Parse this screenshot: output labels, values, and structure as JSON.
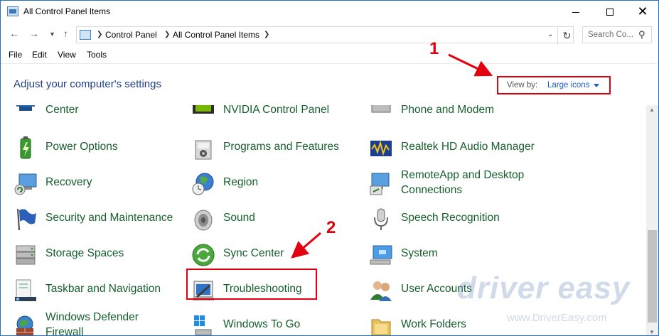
{
  "window": {
    "title": "All Control Panel Items",
    "close_glyph": "✕"
  },
  "address": {
    "crumbs": [
      "Control Panel",
      "All Control Panel Items"
    ],
    "search_placeholder": "Search Co..."
  },
  "menu": [
    "File",
    "Edit",
    "View",
    "Tools"
  ],
  "header": {
    "title": "Adjust your computer's settings",
    "view_by_label": "View by:",
    "view_by_value": "Large icons"
  },
  "items": {
    "col1": [
      "Center",
      "Power Options",
      "Recovery",
      "Security and Maintenance",
      "Storage Spaces",
      "Taskbar and Navigation",
      "Windows Defender Firewall"
    ],
    "col2": [
      "NVIDIA Control Panel",
      "Programs and Features",
      "Region",
      "Sound",
      "Sync Center",
      "Troubleshooting",
      "Windows To Go"
    ],
    "col3": [
      "Phone and Modem",
      "Realtek HD Audio Manager",
      "RemoteApp and Desktop Connections",
      "Speech Recognition",
      "System",
      "User Accounts",
      "Work Folders"
    ]
  },
  "annotations": {
    "marker_1": "1",
    "marker_2": "2",
    "highlight_color": "#e3000f"
  },
  "watermark": {
    "logo": "driver easy",
    "url": "www.DriverEasy.com"
  },
  "colors": {
    "item_text": "#155f2c",
    "heading": "#1e3f8a",
    "link": "#1a5dc9"
  }
}
